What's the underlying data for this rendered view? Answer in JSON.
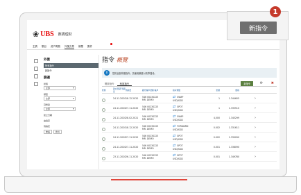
{
  "app": {
    "logo_mark": "❀",
    "logo_text": "UBS",
    "title": "數碼理財"
  },
  "nav": {
    "items": [
      "主頁",
      "賬目",
      "资产概覽",
      "外匯交易",
      "新聞",
      "郵件"
    ],
    "active_index": 3
  },
  "sidebar": {
    "heading": "外匯",
    "items": [
      "所有指令",
      "新指令"
    ],
    "selected_index": 0,
    "filter_heading": "篩選",
    "filters": [
      {
        "label": "狀態",
        "value": "全部"
      },
      {
        "label": "類型",
        "value": "全部"
      },
      {
        "label": "貨幣對",
        "value": "全部"
      }
    ],
    "date_labels": [
      "建立日期",
      "由指定",
      "到指定"
    ],
    "buttons": {
      "reset": "重設",
      "apply": "搜尋"
    }
  },
  "main": {
    "title": "指令",
    "title_suffix": "概覽",
    "info_text": "您的全部外匯指令。請使用篩選以精準搜尋。",
    "tabs": [
      "開放指令",
      "有效指令"
    ],
    "active_tab": 1,
    "new_button": "新指令",
    "columns": [
      "狀態",
      "建立日期 到期日",
      "到期日",
      "銀行帳戶號碼 帳戶",
      "指令類型",
      "金額",
      "價格"
    ],
    "rows": [
      {
        "created": "24.11.2020",
        "expiry": "18.12.2020",
        "account": "546 00230223",
        "holder": "MR. DEMO",
        "type": "SWAP",
        "pair": "USD/SGD",
        "amount": "1",
        "price": "1.344605"
      },
      {
        "created": "24.11.2020",
        "expiry": "27.11.2020",
        "account": "546 00230223",
        "holder": "MR. DEMO",
        "type": "SPOT",
        "pair": "USD/SGD",
        "amount": "1",
        "price": "1.335510"
      },
      {
        "created": "24.11.2020",
        "expiry": "28.02.2021",
        "account": "546 00230223",
        "holder": "MR. DEMO",
        "type": "SWAP",
        "pair": "USD/SGD",
        "amount": "4,000",
        "price": "1.345299"
      },
      {
        "created": "24.11.2020",
        "expiry": "18.12.2020",
        "account": "546 00230223",
        "holder": "MR. DEMO",
        "type": "FORWARD",
        "pair": "USD/SGD",
        "amount": "0.002",
        "price": "1.331611"
      },
      {
        "created": "24.11.2020",
        "expiry": "27.11.2020",
        "account": "546 00230223",
        "holder": "MR. DEMO",
        "type": "SPOT",
        "pair": "USD/SGD",
        "amount": "0.002",
        "price": "1.339090"
      },
      {
        "created": "24.11.2020",
        "expiry": "27.11.2020",
        "account": "546 00230223",
        "holder": "MR. DEMO",
        "type": "SPOT",
        "pair": "USD/SGD",
        "amount": "0.001",
        "price": "1.338090"
      },
      {
        "created": "23.11.2020",
        "expiry": "26.11.2020",
        "account": "546 00230223",
        "holder": "MR. DEMO",
        "type": "SPOT",
        "pair": "USD/SGD",
        "amount": "0.001",
        "price": "1.349780"
      }
    ]
  },
  "callout": {
    "button": "新指令",
    "step_number": "1"
  },
  "colors": {
    "brand_red": "#e60000",
    "callout_badge": "#c53a2b",
    "button_gray": "#6f6f6f",
    "info_blue": "#1678c2"
  }
}
